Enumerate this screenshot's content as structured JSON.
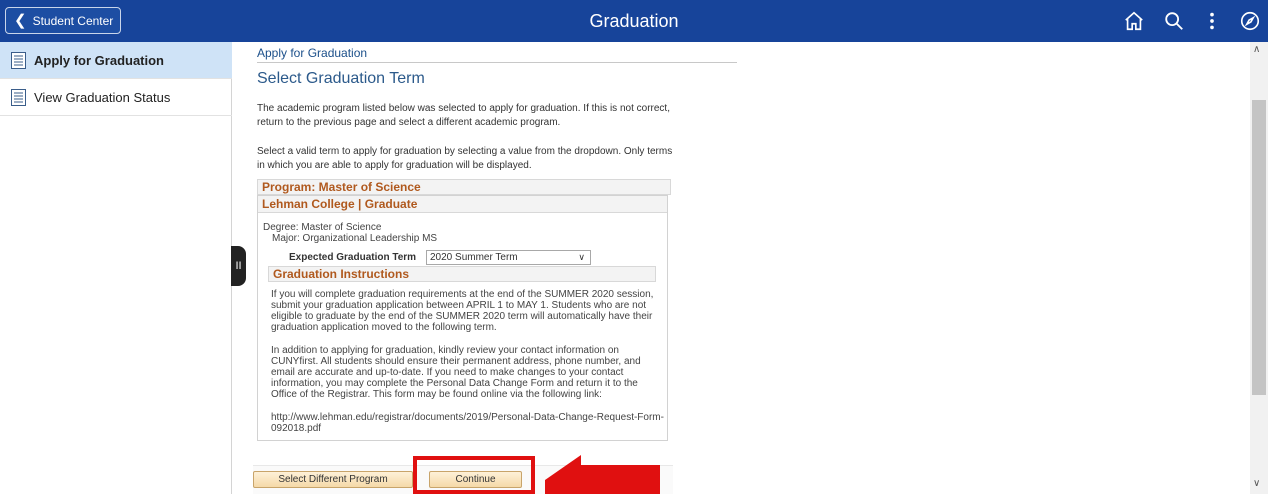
{
  "header": {
    "back_label": "Student Center",
    "title": "Graduation",
    "icons": [
      "home-icon",
      "search-icon",
      "more-vertical-icon",
      "navbar-compass-icon"
    ]
  },
  "sidebar": {
    "items": [
      {
        "label": "Apply for Graduation",
        "active": true
      },
      {
        "label": "View Graduation Status",
        "active": false
      }
    ]
  },
  "main": {
    "breadcrumb": "Apply for Graduation",
    "title": "Select Graduation Term",
    "para1": "The academic program listed below was selected to apply for graduation. If this is not correct, return to the previous page and select a different academic program.",
    "para2": "Select a valid term to apply for graduation by selecting a value from the dropdown. Only terms in which you are able to apply for graduation will be displayed.",
    "program_header": "Program: Master of Science",
    "college_header": "Lehman College | Graduate",
    "degree": "Degree: Master of Science",
    "major": "Major: Organizational Leadership MS",
    "expected_term_label": "Expected Graduation Term",
    "expected_term_value": "2020 Summer Term",
    "instructions_header": "Graduation Instructions",
    "instr1": "If you will complete graduation requirements at the end of the SUMMER 2020 session, submit your graduation application between APRIL 1 to MAY 1. Students who are not eligible to graduate by the end of the SUMMER 2020 term will automatically have their graduation application moved to the following term.",
    "instr2": "In addition to applying for graduation, kindly review your contact information on CUNYfirst. All students should ensure their permanent address, phone number, and email are accurate and up-to-date. If you need to make changes to your contact information, you may complete the Personal Data Change Form and return it to the Office of the Registrar. This form may be found online via the following link:",
    "instr3": "http://www.lehman.edu/registrar/documents/2019/Personal-Data-Change-Request-Form-092018.pdf",
    "btn_select_program": "Select Different Program",
    "btn_continue": "Continue"
  },
  "colors": {
    "topbar": "#17449a",
    "section_header_text": "#b0591e",
    "annotation": "#e01010"
  }
}
